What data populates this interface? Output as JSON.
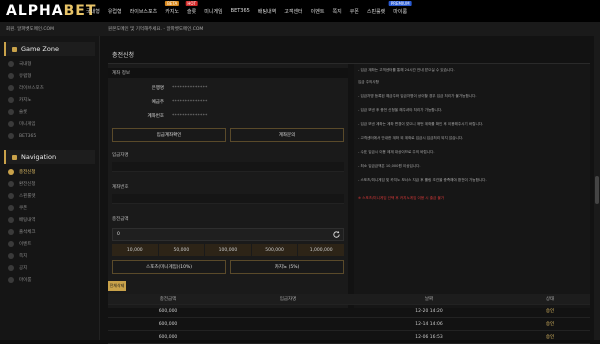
{
  "brand": {
    "logo_left": "ALPHA",
    "logo_right": "BET"
  },
  "nav": [
    {
      "label": "국내형",
      "badge": ""
    },
    {
      "label": "유럽형",
      "badge": ""
    },
    {
      "label": "라이브스포츠",
      "badge": ""
    },
    {
      "label": "카지노",
      "badge": "BETA"
    },
    {
      "label": "슬롯",
      "badge": "HOT"
    },
    {
      "label": "미니게임",
      "badge": ""
    },
    {
      "label": "BET365",
      "badge": ""
    },
    {
      "label": "배팅내역",
      "badge": ""
    },
    {
      "label": "고객센터",
      "badge": ""
    },
    {
      "label": "이벤트",
      "badge": ""
    },
    {
      "label": "쪽지",
      "badge": ""
    },
    {
      "label": "쿠폰",
      "badge": ""
    },
    {
      "label": "스핀룰렛",
      "badge": ""
    },
    {
      "label": "마이룸",
      "badge": "PREMIUM"
    }
  ],
  "notice": {
    "left": "회원. 알파벳도메인.COM",
    "right": "원본도메인 및 기억해주세요. - 알파벳도메인.COM"
  },
  "sidebar": {
    "game_zone": "Game Zone",
    "game_items": [
      "국내형",
      "유럽형",
      "라이브스포츠",
      "카지노",
      "슬롯",
      "미니게임",
      "BET365"
    ],
    "navigation": "Navigation",
    "nav_items": [
      "충전신청",
      "환전신청",
      "스핀룰렛",
      "쿠폰",
      "배팅내역",
      "출석체크",
      "이벤트",
      "쪽지",
      "공지",
      "마이룸"
    ]
  },
  "page": {
    "title": "충전신청"
  },
  "account": {
    "section": "계좌 정보",
    "bank_label": "은행명",
    "bank_value": "**************",
    "holder_label": "예금주",
    "holder_value": "**************",
    "number_label": "계좌번호",
    "number_value": "**************",
    "btn_check": "입금계좌확인",
    "btn_copy": "계좌문의"
  },
  "fields": {
    "depositor": "입금자명",
    "account_no": "계좌번호",
    "amount": "충전금액",
    "amount_value": "0"
  },
  "amount_buttons": [
    "10,000",
    "50,000",
    "100,000",
    "500,000",
    "1,000,000"
  ],
  "bonus_buttons": [
    "스포츠(미니게임)(10%)",
    "카지노 (5%)"
  ],
  "info_lines": [
    {
      "text": "- 입금 계좌는 고객센터를 통해 24시간 안내 받으실 수 있습니다.",
      "red": false
    },
    {
      "text": "입금 주의사항",
      "red": false
    },
    {
      "text": "- 입금자명 등록된 예금주와 입금자명이 상이할 경우 입금 처리가 불가능합니다.",
      "red": false
    },
    {
      "text": "- 입금 보낸 후 충전 신청을 해주셔야 처리가 가능합니다.",
      "red": false
    },
    {
      "text": "- 입금 보낸 계좌는 계좌 변경이 잦으니 매번 계좌를 확인 후 이용해주시기 바랍니다.",
      "red": false
    },
    {
      "text": "- 고객센터에서 안내한 계좌 외 계좌로 입금시 입금처리 되지 않습니다.",
      "red": false
    },
    {
      "text": "- 수표 입금시 이용 제재 대상이므로 주의 바랍니다.",
      "red": false
    },
    {
      "text": "- 최소 입금금액은 10,000원 이상입니다.",
      "red": false
    },
    {
      "text": "- 스포츠/미니게임 및 카지노 보너스 지급 후 롤링 조건을 충족해야 환전이 가능합니다.",
      "red": false
    },
    {
      "text": "※ 스포츠/미니게임 선택 후 카지노게임 이용 시 출금 불가",
      "red": true
    }
  ],
  "history_button": "전체삭제",
  "table": {
    "headers": [
      "충전금액",
      "입금자명",
      "날짜",
      "상태"
    ],
    "rows": [
      [
        "600,000",
        "",
        "12-20 14:20",
        "승인"
      ],
      [
        "600,000",
        "",
        "12-14 14:06",
        "승인"
      ],
      [
        "600,000",
        "",
        "12-06 16:53",
        "승인"
      ]
    ]
  }
}
